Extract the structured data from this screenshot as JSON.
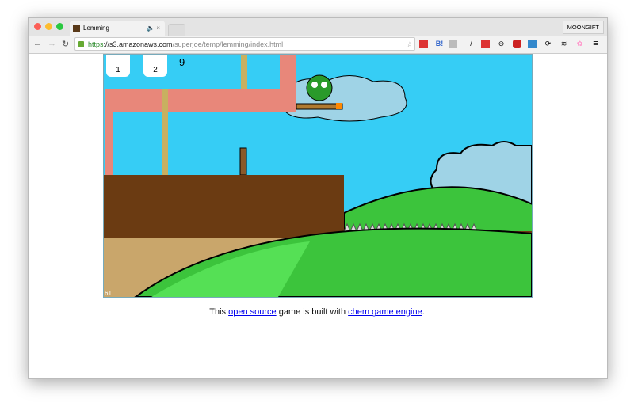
{
  "browser": {
    "tab_title": "Lemming",
    "profile": "MOONGIFT",
    "url": {
      "scheme": "https",
      "host": "://s3.amazonaws.com",
      "path": "/superjoe/temp/lemming/index.html"
    },
    "icons": [
      "back-icon",
      "forward-icon",
      "reload-icon",
      "lock-icon",
      "star-icon",
      "menu-icon"
    ]
  },
  "game": {
    "tools": [
      {
        "icon": "plank-icon",
        "count": "1"
      },
      {
        "icon": "rope-icon",
        "count": "2"
      }
    ],
    "score": "9",
    "fps": "61",
    "colors": {
      "sky": "#36cdf5",
      "brick": "#e8877a",
      "dirt": "#6b3b12",
      "grass": "#3cc43c",
      "sand": "#c9a66b"
    }
  },
  "caption": {
    "before": "This ",
    "link1": "open source",
    "middle": " game is built with ",
    "link2": "chem game engine",
    "after": "."
  }
}
